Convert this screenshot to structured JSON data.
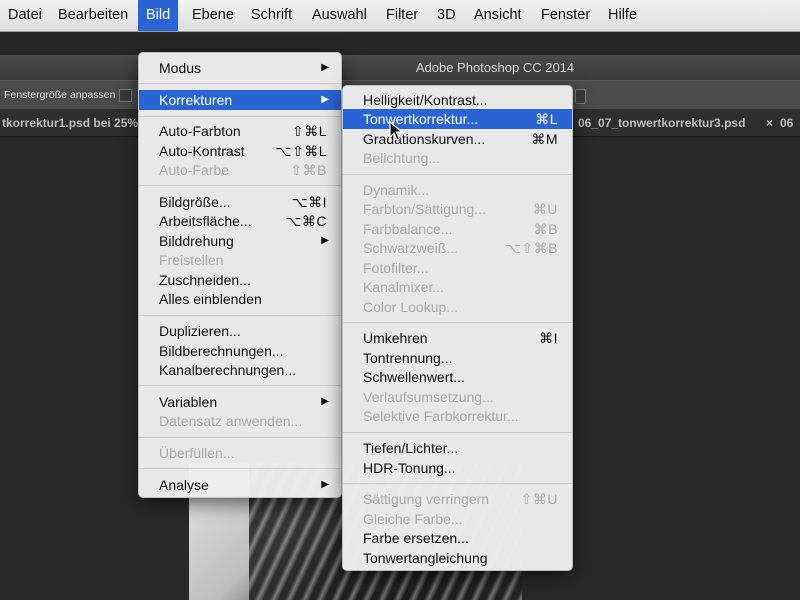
{
  "menubar": {
    "items": [
      {
        "label": "Datei"
      },
      {
        "label": "Bearbeiten"
      },
      {
        "label": "Bild"
      },
      {
        "label": "Ebene"
      },
      {
        "label": "Schrift"
      },
      {
        "label": "Auswahl"
      },
      {
        "label": "Filter"
      },
      {
        "label": "3D"
      },
      {
        "label": "Ansicht"
      },
      {
        "label": "Fenster"
      },
      {
        "label": "Hilfe"
      }
    ],
    "active": "Bild"
  },
  "window": {
    "title": "Adobe Photoshop CC 2014"
  },
  "options_bar": {
    "fit_window_label": "Fenstergröße anpassen"
  },
  "tabs": [
    {
      "label": "tkorrektur1.psd bei 25%"
    },
    {
      "label": "06_07_tonwertkorrektur3.psd"
    },
    {
      "close": "×",
      "label": "06"
    }
  ],
  "bild_menu": {
    "items": [
      {
        "label": "Modus",
        "submenu": true
      },
      {
        "label": "Korrekturen",
        "submenu": true,
        "highlighted": true
      },
      {
        "label": "Auto-Farbton",
        "shortcut": "⇧⌘L"
      },
      {
        "label": "Auto-Kontrast",
        "shortcut": "⌥⇧⌘L"
      },
      {
        "label": "Auto-Farbe",
        "shortcut": "⇧⌘B",
        "disabled": true
      },
      {
        "label": "Bildgröße...",
        "shortcut": "⌥⌘I"
      },
      {
        "label": "Arbeitsfläche...",
        "shortcut": "⌥⌘C"
      },
      {
        "label": "Bilddrehung",
        "submenu": true
      },
      {
        "label": "Freistellen",
        "disabled": true
      },
      {
        "label": "Zuschneiden..."
      },
      {
        "label": "Alles einblenden"
      },
      {
        "label": "Duplizieren..."
      },
      {
        "label": "Bildberechnungen..."
      },
      {
        "label": "Kanalberechnungen..."
      },
      {
        "label": "Variablen",
        "submenu": true
      },
      {
        "label": "Datensatz anwenden...",
        "disabled": true
      },
      {
        "label": "Überfüllen...",
        "disabled": true
      },
      {
        "label": "Analyse",
        "submenu": true
      }
    ]
  },
  "korrekturen_menu": {
    "items": [
      {
        "label": "Helligkeit/Kontrast..."
      },
      {
        "label": "Tonwertkorrektur...",
        "shortcut": "⌘L",
        "highlighted": true
      },
      {
        "label": "Gradationskurven...",
        "shortcut": "⌘M"
      },
      {
        "label": "Belichtung...",
        "disabled": true
      },
      {
        "label": "Dynamik...",
        "disabled": true
      },
      {
        "label": "Farbton/Sättigung...",
        "shortcut": "⌘U",
        "disabled": true
      },
      {
        "label": "Farbbalance...",
        "shortcut": "⌘B",
        "disabled": true
      },
      {
        "label": "Schwarzweiß...",
        "shortcut": "⌥⇧⌘B",
        "disabled": true
      },
      {
        "label": "Fotofilter...",
        "disabled": true
      },
      {
        "label": "Kanalmixer...",
        "disabled": true
      },
      {
        "label": "Color Lookup...",
        "disabled": true
      },
      {
        "label": "Umkehren",
        "shortcut": "⌘I"
      },
      {
        "label": "Tontrennung..."
      },
      {
        "label": "Schwellenwert..."
      },
      {
        "label": "Verlaufsumsetzung...",
        "disabled": true
      },
      {
        "label": "Selektive Farbkorrektur...",
        "disabled": true
      },
      {
        "label": "Tiefen/Lichter..."
      },
      {
        "label": "HDR-Tonung..."
      },
      {
        "label": "Sättigung verringern",
        "shortcut": "⇧⌘U",
        "disabled": true
      },
      {
        "label": "Gleiche Farbe...",
        "disabled": true
      },
      {
        "label": "Farbe ersetzen..."
      },
      {
        "label": "Tonwertangleichung"
      }
    ]
  },
  "icons": {
    "submenu_arrow": "triangle-right-icon",
    "cursor": "arrow-pointer-icon",
    "checkbox": "checkbox-icon"
  },
  "colors": {
    "highlight": "#2a63d4",
    "menu_bg": "#eeeeee",
    "menubar_bg": "#e8e8e8",
    "disabled_text": "#a9a9a9",
    "app_bg": "#262626"
  }
}
